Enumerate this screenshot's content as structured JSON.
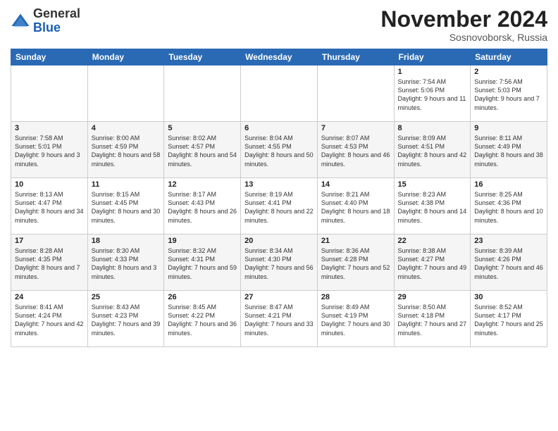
{
  "logo": {
    "general": "General",
    "blue": "Blue"
  },
  "header": {
    "month": "November 2024",
    "location": "Sosnovoborsk, Russia"
  },
  "days_of_week": [
    "Sunday",
    "Monday",
    "Tuesday",
    "Wednesday",
    "Thursday",
    "Friday",
    "Saturday"
  ],
  "weeks": [
    [
      {
        "day": "",
        "info": ""
      },
      {
        "day": "",
        "info": ""
      },
      {
        "day": "",
        "info": ""
      },
      {
        "day": "",
        "info": ""
      },
      {
        "day": "",
        "info": ""
      },
      {
        "day": "1",
        "info": "Sunrise: 7:54 AM\nSunset: 5:06 PM\nDaylight: 9 hours and 11 minutes."
      },
      {
        "day": "2",
        "info": "Sunrise: 7:56 AM\nSunset: 5:03 PM\nDaylight: 9 hours and 7 minutes."
      }
    ],
    [
      {
        "day": "3",
        "info": "Sunrise: 7:58 AM\nSunset: 5:01 PM\nDaylight: 9 hours and 3 minutes."
      },
      {
        "day": "4",
        "info": "Sunrise: 8:00 AM\nSunset: 4:59 PM\nDaylight: 8 hours and 58 minutes."
      },
      {
        "day": "5",
        "info": "Sunrise: 8:02 AM\nSunset: 4:57 PM\nDaylight: 8 hours and 54 minutes."
      },
      {
        "day": "6",
        "info": "Sunrise: 8:04 AM\nSunset: 4:55 PM\nDaylight: 8 hours and 50 minutes."
      },
      {
        "day": "7",
        "info": "Sunrise: 8:07 AM\nSunset: 4:53 PM\nDaylight: 8 hours and 46 minutes."
      },
      {
        "day": "8",
        "info": "Sunrise: 8:09 AM\nSunset: 4:51 PM\nDaylight: 8 hours and 42 minutes."
      },
      {
        "day": "9",
        "info": "Sunrise: 8:11 AM\nSunset: 4:49 PM\nDaylight: 8 hours and 38 minutes."
      }
    ],
    [
      {
        "day": "10",
        "info": "Sunrise: 8:13 AM\nSunset: 4:47 PM\nDaylight: 8 hours and 34 minutes."
      },
      {
        "day": "11",
        "info": "Sunrise: 8:15 AM\nSunset: 4:45 PM\nDaylight: 8 hours and 30 minutes."
      },
      {
        "day": "12",
        "info": "Sunrise: 8:17 AM\nSunset: 4:43 PM\nDaylight: 8 hours and 26 minutes."
      },
      {
        "day": "13",
        "info": "Sunrise: 8:19 AM\nSunset: 4:41 PM\nDaylight: 8 hours and 22 minutes."
      },
      {
        "day": "14",
        "info": "Sunrise: 8:21 AM\nSunset: 4:40 PM\nDaylight: 8 hours and 18 minutes."
      },
      {
        "day": "15",
        "info": "Sunrise: 8:23 AM\nSunset: 4:38 PM\nDaylight: 8 hours and 14 minutes."
      },
      {
        "day": "16",
        "info": "Sunrise: 8:25 AM\nSunset: 4:36 PM\nDaylight: 8 hours and 10 minutes."
      }
    ],
    [
      {
        "day": "17",
        "info": "Sunrise: 8:28 AM\nSunset: 4:35 PM\nDaylight: 8 hours and 7 minutes."
      },
      {
        "day": "18",
        "info": "Sunrise: 8:30 AM\nSunset: 4:33 PM\nDaylight: 8 hours and 3 minutes."
      },
      {
        "day": "19",
        "info": "Sunrise: 8:32 AM\nSunset: 4:31 PM\nDaylight: 7 hours and 59 minutes."
      },
      {
        "day": "20",
        "info": "Sunrise: 8:34 AM\nSunset: 4:30 PM\nDaylight: 7 hours and 56 minutes."
      },
      {
        "day": "21",
        "info": "Sunrise: 8:36 AM\nSunset: 4:28 PM\nDaylight: 7 hours and 52 minutes."
      },
      {
        "day": "22",
        "info": "Sunrise: 8:38 AM\nSunset: 4:27 PM\nDaylight: 7 hours and 49 minutes."
      },
      {
        "day": "23",
        "info": "Sunrise: 8:39 AM\nSunset: 4:26 PM\nDaylight: 7 hours and 46 minutes."
      }
    ],
    [
      {
        "day": "24",
        "info": "Sunrise: 8:41 AM\nSunset: 4:24 PM\nDaylight: 7 hours and 42 minutes."
      },
      {
        "day": "25",
        "info": "Sunrise: 8:43 AM\nSunset: 4:23 PM\nDaylight: 7 hours and 39 minutes."
      },
      {
        "day": "26",
        "info": "Sunrise: 8:45 AM\nSunset: 4:22 PM\nDaylight: 7 hours and 36 minutes."
      },
      {
        "day": "27",
        "info": "Sunrise: 8:47 AM\nSunset: 4:21 PM\nDaylight: 7 hours and 33 minutes."
      },
      {
        "day": "28",
        "info": "Sunrise: 8:49 AM\nSunset: 4:19 PM\nDaylight: 7 hours and 30 minutes."
      },
      {
        "day": "29",
        "info": "Sunrise: 8:50 AM\nSunset: 4:18 PM\nDaylight: 7 hours and 27 minutes."
      },
      {
        "day": "30",
        "info": "Sunrise: 8:52 AM\nSunset: 4:17 PM\nDaylight: 7 hours and 25 minutes."
      }
    ]
  ]
}
